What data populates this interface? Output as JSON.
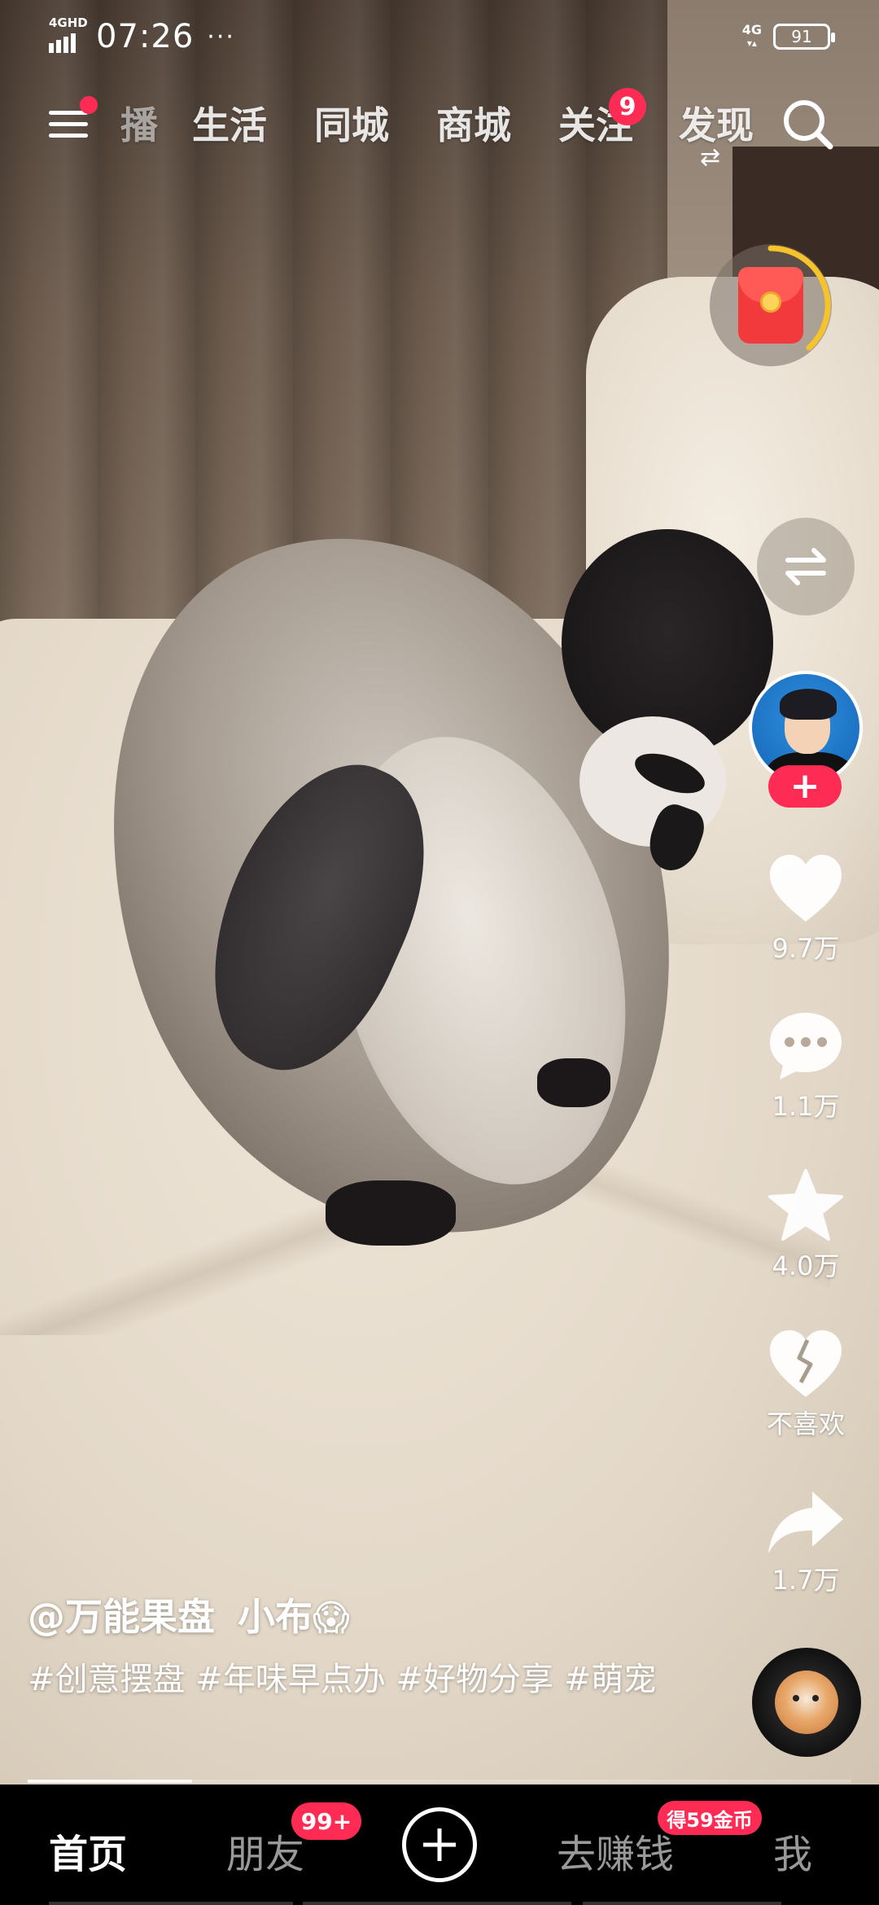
{
  "status_bar": {
    "network": "4GHD",
    "time": "07:26",
    "more": "···",
    "network_right": "4G",
    "battery": "91"
  },
  "top_nav": {
    "tabs": [
      "播",
      "生活",
      "同城",
      "商城",
      "关注",
      "发现"
    ],
    "follow_badge": "9"
  },
  "side_actions": {
    "likes": "9.7万",
    "comments": "1.1万",
    "favorites": "4.0万",
    "dislike": "不喜欢",
    "shares": "1.7万",
    "follow_plus": "+"
  },
  "caption": {
    "author": "@万能果盘",
    "title": "小布",
    "title_emoji": "😱",
    "hashtags": "#创意摆盘 #年味早点办 #好物分享 #萌宠"
  },
  "playback": {
    "progress_fraction": 0.2
  },
  "bottom_nav": {
    "home": "首页",
    "friends": "朋友",
    "friends_badge": "99+",
    "earn": "去赚钱",
    "earn_badge": "得59金币",
    "me": "我"
  },
  "colors": {
    "accent": "#fe2c55",
    "nav_background": "#000000"
  },
  "icons": [
    "menu-icon",
    "search-icon",
    "red-packet-icon",
    "swap-icon",
    "heart-icon",
    "comment-icon",
    "star-icon",
    "broken-heart-icon",
    "share-icon",
    "music-disc-icon",
    "plus-icon"
  ]
}
